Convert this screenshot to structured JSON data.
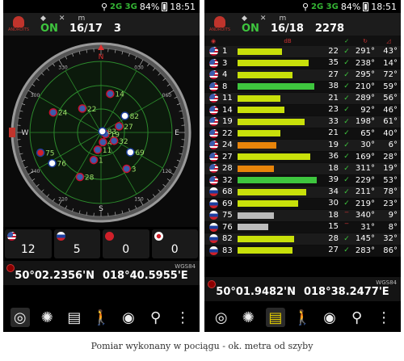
{
  "status": {
    "time": "18:51",
    "battery": "84%",
    "net_left": "2G 3G",
    "net_right": "2G 3G"
  },
  "colors": {
    "on": "#3ec63e",
    "bar_yellow": "#c8e00a",
    "bar_green": "#3ec63e",
    "bar_orange": "#e8840a",
    "bar_gray": "#bbbbbb"
  },
  "left": {
    "fix": {
      "status": "ON",
      "sats": "16/17",
      "accuracy": "3"
    },
    "compass_labels": {
      "north": "N",
      "east": "E",
      "south": "S",
      "west": "W",
      "ring": [
        "330",
        "300",
        "240",
        "210",
        "150",
        "120",
        "060",
        "030"
      ]
    },
    "sky_sats": [
      {
        "id": "24",
        "type": "us",
        "az": 295,
        "el": 30
      },
      {
        "id": "22",
        "type": "us",
        "az": 330,
        "el": 55
      },
      {
        "id": "14",
        "type": "us",
        "az": 20,
        "el": 38
      },
      {
        "id": "82",
        "type": "ru",
        "az": 60,
        "el": 48
      },
      {
        "id": "27",
        "type": "us",
        "az": 75,
        "el": 60
      },
      {
        "id": "75",
        "type": "cn",
        "az": 250,
        "el": 15
      },
      {
        "id": "76",
        "type": "ru",
        "az": 235,
        "el": 22
      },
      {
        "id": "28",
        "type": "us",
        "az": 200,
        "el": 30
      },
      {
        "id": "1",
        "type": "us",
        "az": 185,
        "el": 55
      },
      {
        "id": "11",
        "type": "us",
        "az": 175,
        "el": 68
      },
      {
        "id": "4",
        "type": "us",
        "az": 145,
        "el": 75
      },
      {
        "id": "32",
        "type": "us",
        "az": 115,
        "el": 65
      },
      {
        "id": "69",
        "type": "ru",
        "az": 120,
        "el": 40
      },
      {
        "id": "3",
        "type": "us",
        "az": 140,
        "el": 30
      },
      {
        "id": "19",
        "type": "us",
        "az": 100,
        "el": 78
      },
      {
        "id": "83",
        "type": "ru",
        "az": 80,
        "el": 82
      }
    ],
    "counts": [
      {
        "label": "12",
        "flag": "us"
      },
      {
        "label": "5",
        "flag": "ru"
      },
      {
        "label": "0",
        "flag": "cn"
      },
      {
        "label": "0",
        "flag": "jp"
      }
    ],
    "datum": "WGS84",
    "lat": "50°02.2356'N",
    "lon": "018°40.5955'E"
  },
  "right": {
    "fix": {
      "status": "ON",
      "sats": "16/18",
      "accuracy": "2278"
    },
    "header_db": "dB",
    "datum": "WGS84",
    "lat": "50°01.9482'N",
    "lon": "018°38.2477'E",
    "rows": [
      {
        "flag": "us",
        "id": "1",
        "snr": 22,
        "ok": true,
        "az": "291°",
        "el": "43°",
        "bar": "yellow"
      },
      {
        "flag": "us",
        "id": "3",
        "snr": 35,
        "ok": true,
        "az": "238°",
        "el": "14°",
        "bar": "yellow"
      },
      {
        "flag": "us",
        "id": "4",
        "snr": 27,
        "ok": true,
        "az": "295°",
        "el": "72°",
        "bar": "yellow"
      },
      {
        "flag": "us",
        "id": "8",
        "snr": 38,
        "ok": true,
        "az": "210°",
        "el": "59°",
        "bar": "green"
      },
      {
        "flag": "us",
        "id": "11",
        "snr": 21,
        "ok": true,
        "az": "289°",
        "el": "56°",
        "bar": "yellow"
      },
      {
        "flag": "us",
        "id": "14",
        "snr": 23,
        "ok": true,
        "az": "92°",
        "el": "46°",
        "bar": "yellow"
      },
      {
        "flag": "us",
        "id": "19",
        "snr": 33,
        "ok": true,
        "az": "198°",
        "el": "61°",
        "bar": "yellow"
      },
      {
        "flag": "us",
        "id": "22",
        "snr": 21,
        "ok": true,
        "az": "65°",
        "el": "40°",
        "bar": "yellow"
      },
      {
        "flag": "us",
        "id": "24",
        "snr": 19,
        "ok": true,
        "az": "30°",
        "el": "6°",
        "bar": "orange"
      },
      {
        "flag": "us",
        "id": "27",
        "snr": 36,
        "ok": true,
        "az": "169°",
        "el": "28°",
        "bar": "yellow"
      },
      {
        "flag": "us",
        "id": "28",
        "snr": 18,
        "ok": true,
        "az": "311°",
        "el": "19°",
        "bar": "orange"
      },
      {
        "flag": "us",
        "id": "32",
        "snr": 39,
        "ok": true,
        "az": "229°",
        "el": "53°",
        "bar": "green"
      },
      {
        "flag": "ru",
        "id": "68",
        "snr": 34,
        "ok": true,
        "az": "211°",
        "el": "78°",
        "bar": "yellow"
      },
      {
        "flag": "ru",
        "id": "69",
        "snr": 30,
        "ok": true,
        "az": "219°",
        "el": "23°",
        "bar": "yellow"
      },
      {
        "flag": "ru",
        "id": "75",
        "snr": 18,
        "ok": false,
        "az": "340°",
        "el": "9°",
        "bar": "gray"
      },
      {
        "flag": "ru",
        "id": "76",
        "snr": 15,
        "ok": false,
        "az": "31°",
        "el": "8°",
        "bar": "gray"
      },
      {
        "flag": "ru",
        "id": "82",
        "snr": 28,
        "ok": true,
        "az": "145°",
        "el": "32°",
        "bar": "yellow"
      },
      {
        "flag": "ru",
        "id": "83",
        "snr": 27,
        "ok": true,
        "az": "283°",
        "el": "86°",
        "bar": "yellow"
      }
    ]
  },
  "caption": "Pomiar wykonany w pociągu - ok. metra od szyby"
}
